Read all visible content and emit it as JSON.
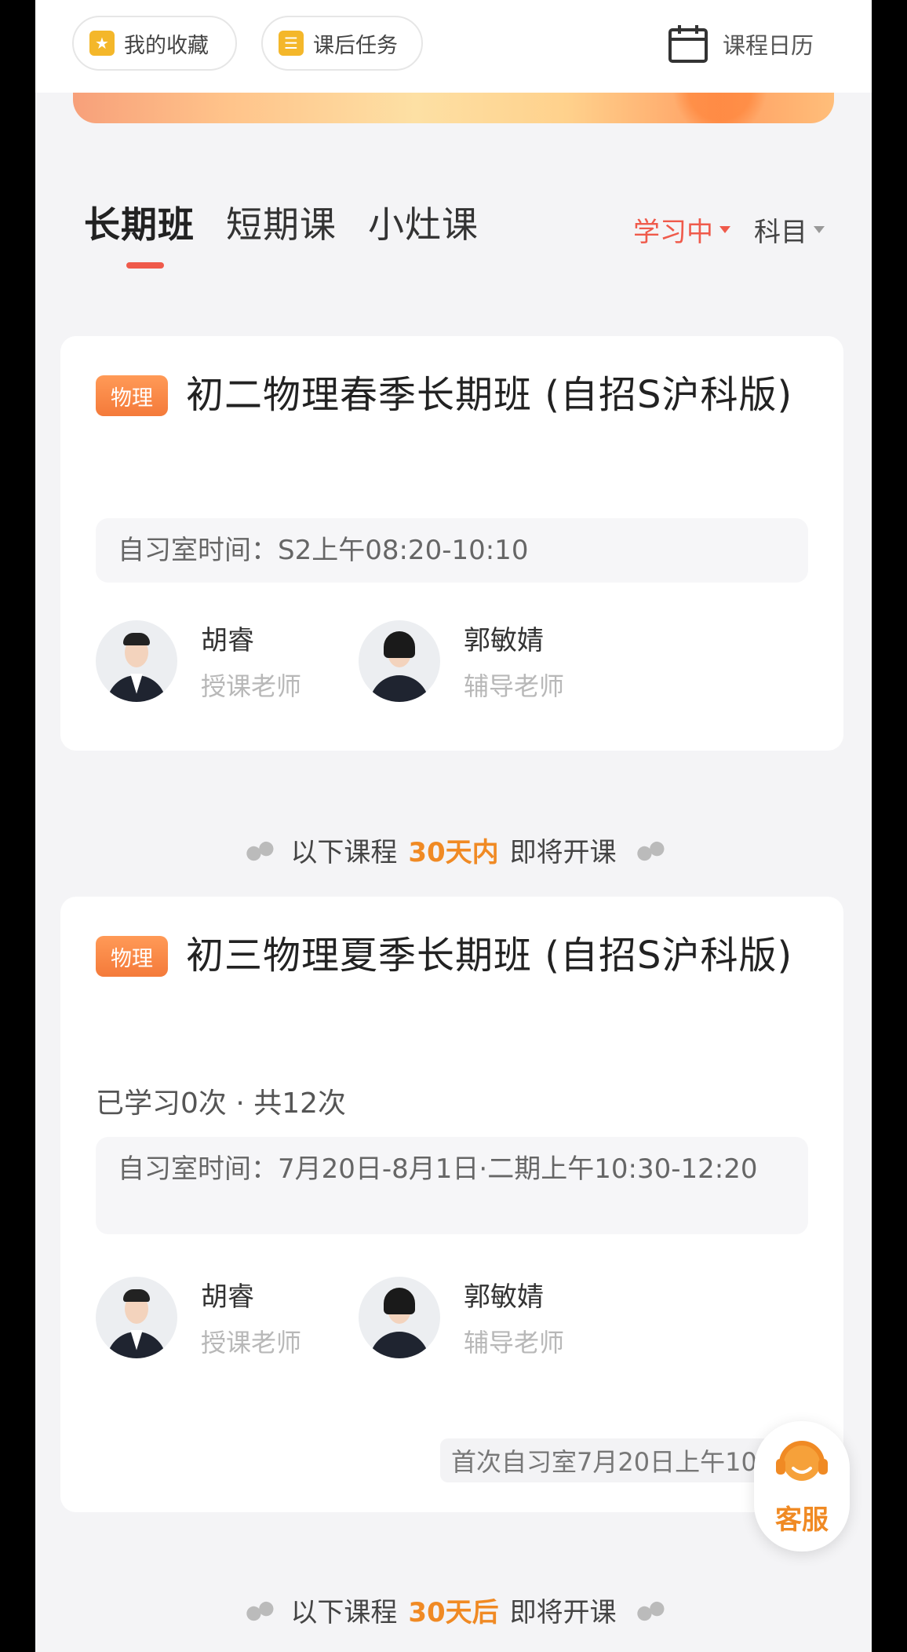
{
  "header": {
    "favorites_label": "我的收藏",
    "tasks_label": "课后任务",
    "calendar_label": "课程日历"
  },
  "tabs": [
    {
      "label": "长期班",
      "active": true
    },
    {
      "label": "短期课",
      "active": false
    },
    {
      "label": "小灶课",
      "active": false
    }
  ],
  "filters": {
    "status": "学习中",
    "subject": "科目"
  },
  "courses": [
    {
      "subject": "物理",
      "title": "初二物理春季长期班 (自招S沪科版)",
      "progress": "",
      "schedule": "自习室时间：S2上午08:20-10:10",
      "teachers": [
        {
          "name": "胡睿",
          "role": "授课老师"
        },
        {
          "name": "郭敏婧",
          "role": "辅导老师"
        }
      ]
    },
    {
      "subject": "物理",
      "title": "初三物理夏季长期班 (自招S沪科版)",
      "progress": "已学习0次 · 共12次",
      "schedule": "自习室时间：7月20日-8月1日·二期上午10:30-12:20",
      "teachers": [
        {
          "name": "胡睿",
          "role": "授课老师"
        },
        {
          "name": "郭敏婧",
          "role": "辅导老师"
        }
      ],
      "first_session": "首次自习室7月20日上午10:30"
    }
  ],
  "dividers": [
    {
      "prefix": "以下课程",
      "highlight": "30天内",
      "suffix": "即将开课"
    },
    {
      "prefix": "以下课程",
      "highlight": "30天后",
      "suffix": "即将开课"
    }
  ],
  "service": {
    "label": "客服"
  },
  "colors": {
    "accent_red": "#ef5a4b",
    "accent_orange": "#f08a24",
    "tag_orange": "#f47a3a",
    "background": "#f4f4f6"
  }
}
